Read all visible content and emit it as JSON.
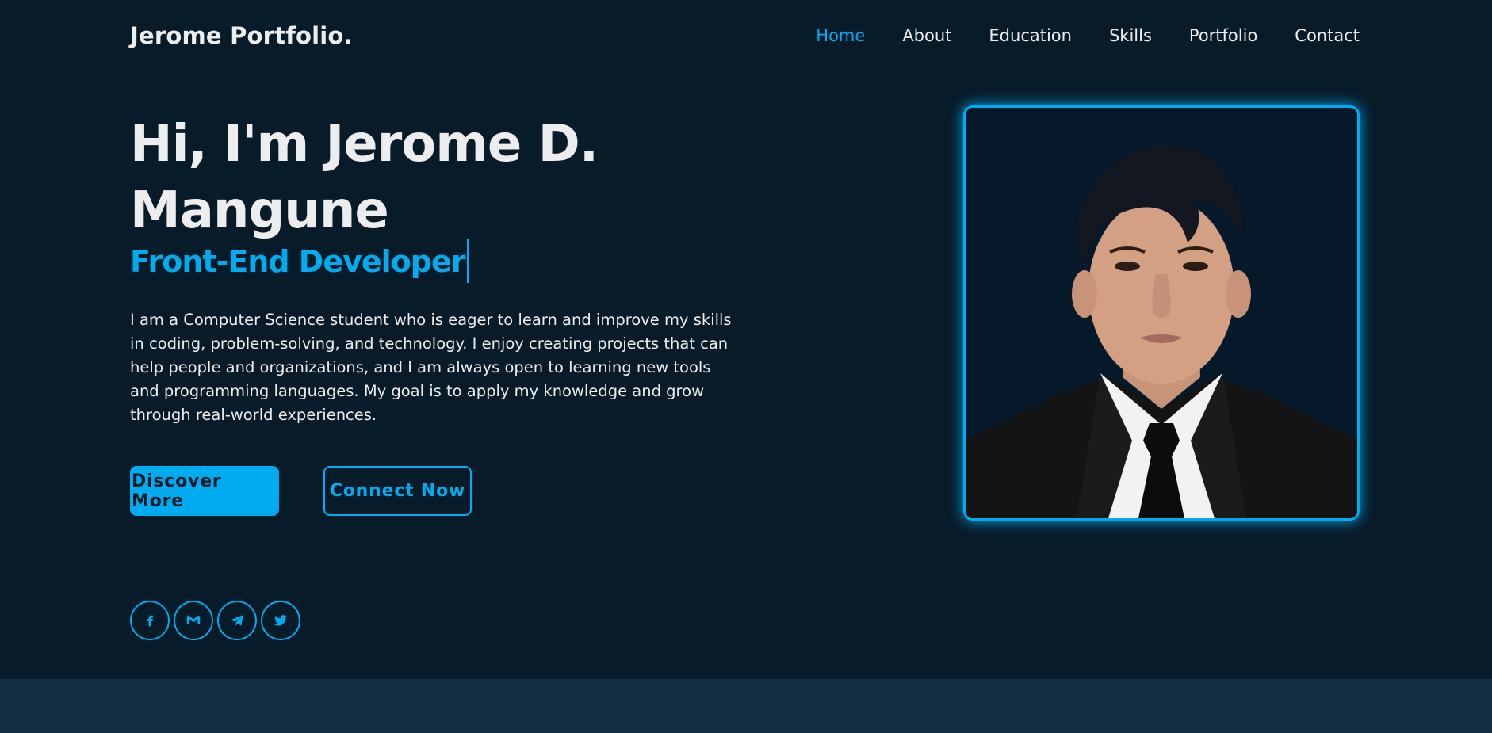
{
  "header": {
    "logo": "Jerome Portfolio.",
    "nav": [
      {
        "label": "Home",
        "active": true
      },
      {
        "label": "About"
      },
      {
        "label": "Education"
      },
      {
        "label": "Skills"
      },
      {
        "label": "Portfolio"
      },
      {
        "label": "Contact"
      }
    ]
  },
  "hero": {
    "title_line1": "Hi, I'm Jerome D.",
    "title_line2": "Mangune",
    "role": "Front-End Developer",
    "description": "I am a Computer Science student who is eager to learn and improve my skills in coding, problem-solving, and technology. I enjoy creating projects that can help people and organizations, and I am always open to learning new tools and programming languages. My goal is to apply my knowledge and grow through real-world experiences.",
    "primary_button": "Discover More",
    "secondary_button": "Connect Now"
  },
  "socials": [
    {
      "icon": "facebook-icon"
    },
    {
      "icon": "gmail-icon"
    },
    {
      "icon": "telegram-icon"
    },
    {
      "icon": "twitter-icon"
    }
  ],
  "colors": {
    "background": "#081b29",
    "accent": "#00abf0",
    "text": "#ededed",
    "band": "#112e42"
  }
}
